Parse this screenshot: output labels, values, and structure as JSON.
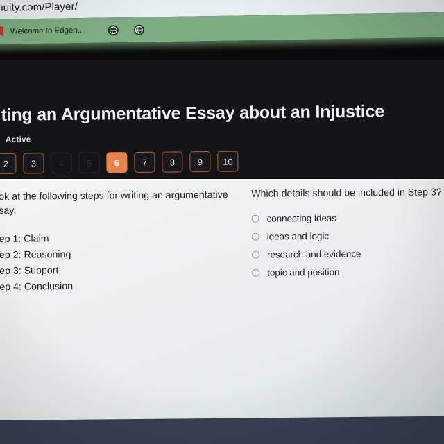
{
  "browser": {
    "url": "nuity.com/Player/",
    "tab_title": "Welcome to Edgen...",
    "logo_icon": "edgenuity-bookmark-icon",
    "tab_icon_1": "globe-icon",
    "tab_icon_2": "globe-icon"
  },
  "header": {
    "lesson_title": "iting an Argumentative Essay about an Injustice",
    "status_label": "Active",
    "status_icon": "progress-circle-icon"
  },
  "pagination": {
    "items": [
      {
        "label": "2",
        "state": "normal"
      },
      {
        "label": "3",
        "state": "normal"
      },
      {
        "label": "4",
        "state": "dim"
      },
      {
        "label": "5",
        "state": "dim"
      },
      {
        "label": "6",
        "state": "active"
      },
      {
        "label": "7",
        "state": "normal"
      },
      {
        "label": "8",
        "state": "normal"
      },
      {
        "label": "9",
        "state": "normal"
      },
      {
        "label": "10",
        "state": "normal"
      }
    ],
    "active_color": "#e8834d",
    "border_color": "#b35f34"
  },
  "left_panel": {
    "prompt": "ok at the following steps for writing an argumentative\nsay.",
    "steps": [
      "ep 1: Claim",
      "ep 2: Reasoning",
      "ep 3: Support",
      "ep 4: Conclusion"
    ]
  },
  "right_panel": {
    "question": "Which details should be included in Step 3?",
    "options": [
      {
        "label": "connecting ideas",
        "selected": false
      },
      {
        "label": "ideas and logic",
        "selected": false
      },
      {
        "label": "research and evidence",
        "selected": false
      },
      {
        "label": "topic and position",
        "selected": false
      }
    ]
  },
  "colors": {
    "tab_strip": "#7fad83",
    "app_header": "#151518",
    "content_bg": "#eceff0",
    "bottom_bar": "#3b3f55"
  }
}
